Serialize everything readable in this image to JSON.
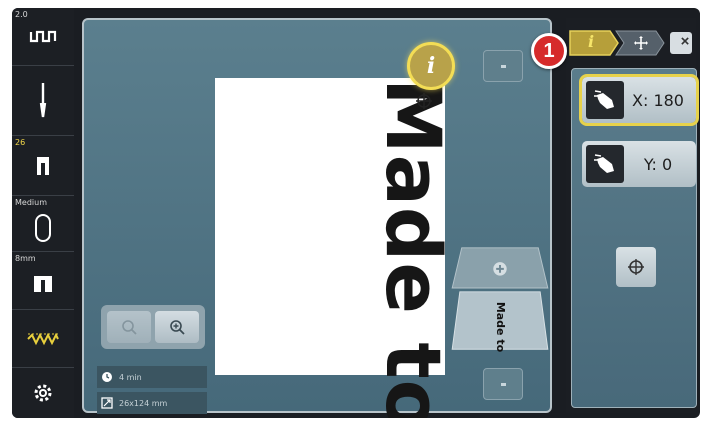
{
  "sidebar": {
    "items": [
      {
        "label": "2.0",
        "icon": "stitch-width-icon"
      },
      {
        "label": "",
        "icon": "needle-icon"
      },
      {
        "label": "26",
        "icon": "presser-foot-icon"
      },
      {
        "label": "Medium",
        "icon": "hoop-icon"
      },
      {
        "label": "8mm",
        "icon": "needle-plate-icon"
      },
      {
        "label": "",
        "icon": "stitch-pattern-icon"
      },
      {
        "label": "",
        "icon": "settings-gear-icon"
      }
    ]
  },
  "embroidery": {
    "text": "Made to"
  },
  "info_button": {
    "label": "i"
  },
  "layers": {
    "selected_label": "Made to"
  },
  "status": {
    "time": "4 min",
    "size": "26x124 mm"
  },
  "tabs": {
    "info_label": "i",
    "close_label": "×"
  },
  "callout": {
    "number": "1"
  },
  "coordinates": {
    "x_label": "X: 180",
    "y_label": "Y: 0"
  },
  "colors": {
    "accent_yellow": "#e7d24b",
    "callout_red": "#d62b2b",
    "panel_teal": "#5a7c8b"
  }
}
